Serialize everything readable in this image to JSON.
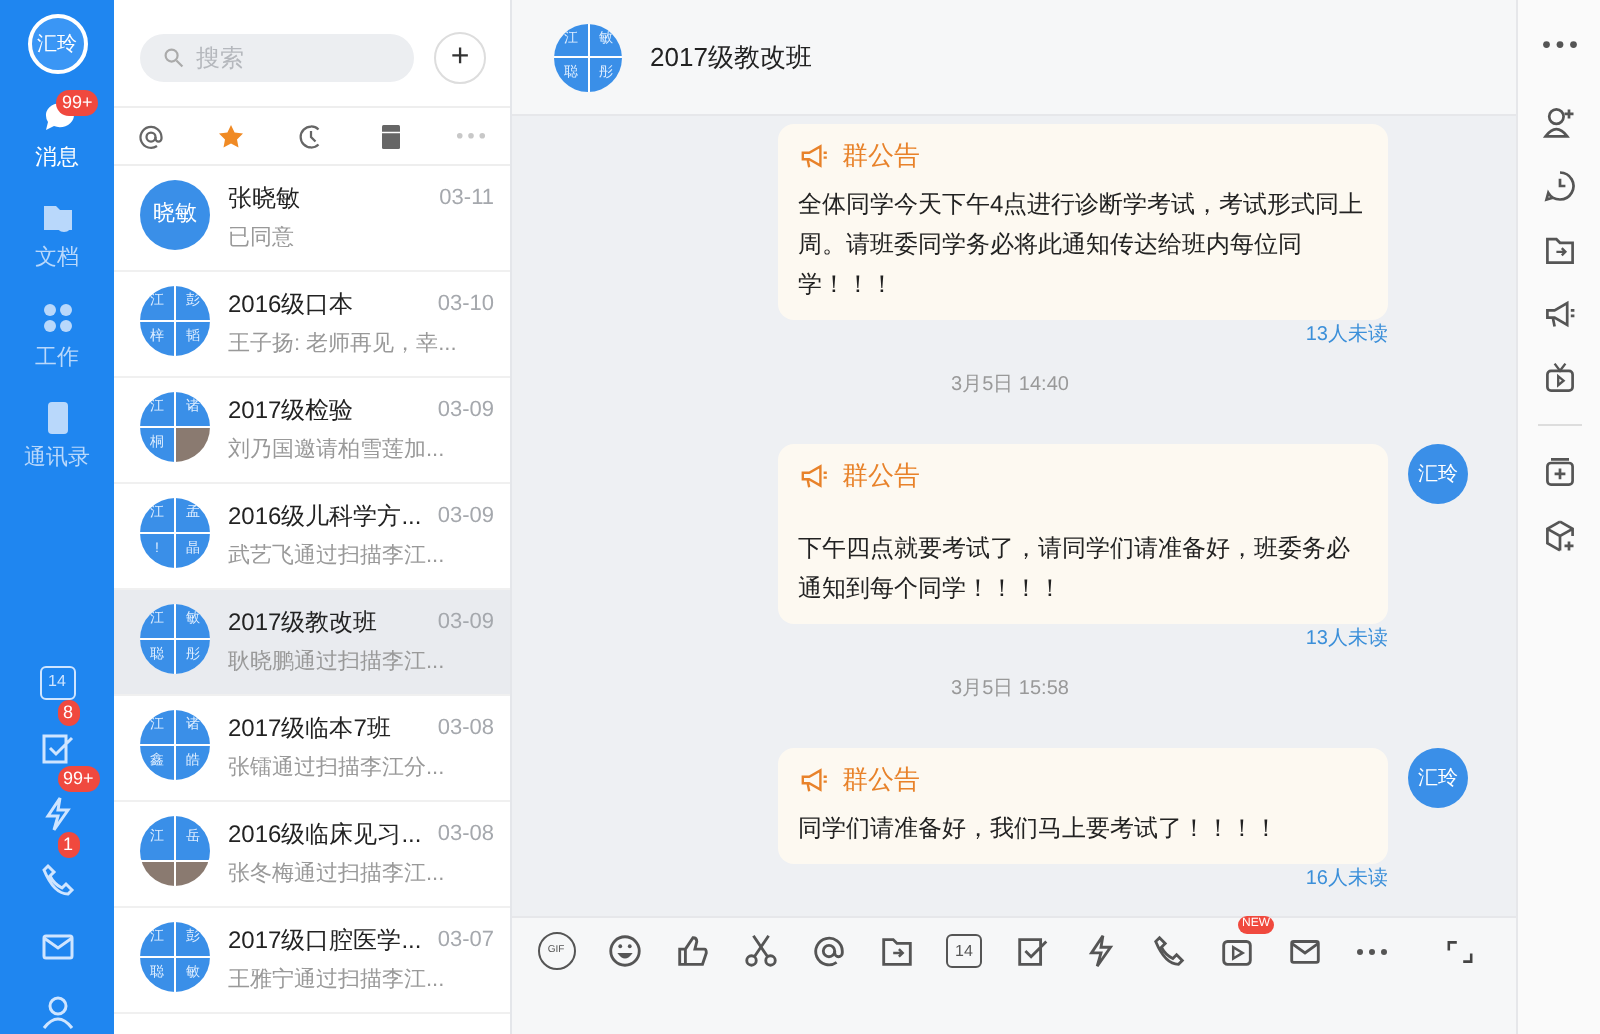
{
  "rail": {
    "avatar": "汇玲",
    "nav": [
      {
        "kind": "chat",
        "label": "消息",
        "selected": true,
        "badge": "99+"
      },
      {
        "kind": "docs",
        "label": "文档",
        "selected": false
      },
      {
        "kind": "work",
        "label": "工作",
        "selected": false
      },
      {
        "kind": "contacts",
        "label": "通讯录",
        "selected": false
      }
    ],
    "tools": [
      {
        "kind": "calendar",
        "label": "14"
      },
      {
        "kind": "check",
        "badge": "8"
      },
      {
        "kind": "bolt",
        "badge": "99+"
      },
      {
        "kind": "phone",
        "badge": "1"
      },
      {
        "kind": "mail"
      },
      {
        "kind": "person"
      }
    ]
  },
  "list": {
    "search": {
      "placeholder": "搜索"
    },
    "add": "+",
    "filters": [
      {
        "kind": "at",
        "selected": false
      },
      {
        "kind": "star",
        "selected": true
      },
      {
        "kind": "recent",
        "selected": false
      },
      {
        "kind": "archive",
        "selected": false
      },
      {
        "kind": "more",
        "selected": false
      }
    ],
    "chats": [
      {
        "name": "张晓敏",
        "time": "03-11",
        "preview": "已同意",
        "avatar": {
          "kind": "single",
          "text": "晓敏"
        },
        "selected": false
      },
      {
        "name": "2016级口本",
        "time": "03-10",
        "preview": "王子扬: 老师再见，幸...",
        "avatar": {
          "kind": "group",
          "cells": [
            {
              "kind": "text",
              "text": "江"
            },
            {
              "kind": "text",
              "text": "彭"
            },
            {
              "kind": "text",
              "text": "梓"
            },
            {
              "kind": "text",
              "text": "韬"
            }
          ]
        },
        "selected": false
      },
      {
        "name": "2017级检验",
        "time": "03-09",
        "preview": "刘乃国邀请柏雪莲加...",
        "avatar": {
          "kind": "group",
          "cells": [
            {
              "kind": "text",
              "text": "江"
            },
            {
              "kind": "text",
              "text": "诸"
            },
            {
              "kind": "text",
              "text": "桐"
            },
            {
              "kind": "photo"
            }
          ]
        },
        "selected": false
      },
      {
        "name": "2016级儿科学方...",
        "time": "03-09",
        "preview": "武艺飞通过扫描李江...",
        "avatar": {
          "kind": "group",
          "cells": [
            {
              "kind": "text",
              "text": "江"
            },
            {
              "kind": "text",
              "text": "孟"
            },
            {
              "kind": "text",
              "text": "!"
            },
            {
              "kind": "text",
              "text": "晶"
            }
          ]
        },
        "selected": false
      },
      {
        "name": "2017级教改班",
        "time": "03-09",
        "preview": "耿晓鹏通过扫描李江...",
        "avatar": {
          "kind": "group",
          "cells": [
            {
              "kind": "text",
              "text": "江"
            },
            {
              "kind": "text",
              "text": "敏"
            },
            {
              "kind": "text",
              "text": "聪"
            },
            {
              "kind": "text",
              "text": "彤"
            }
          ]
        },
        "selected": true
      },
      {
        "name": "2017级临本7班",
        "time": "03-08",
        "preview": "张镭通过扫描李江分...",
        "avatar": {
          "kind": "group",
          "cells": [
            {
              "kind": "text",
              "text": "江"
            },
            {
              "kind": "text",
              "text": "诸"
            },
            {
              "kind": "text",
              "text": "鑫"
            },
            {
              "kind": "text",
              "text": "皓"
            }
          ]
        },
        "selected": false
      },
      {
        "name": "2016级临床见习...",
        "time": "03-08",
        "preview": "张冬梅通过扫描李江...",
        "avatar": {
          "kind": "group",
          "cells": [
            {
              "kind": "text",
              "text": "江"
            },
            {
              "kind": "text",
              "text": "岳"
            },
            {
              "kind": "photo"
            },
            {
              "kind": "photo"
            }
          ]
        },
        "selected": false
      },
      {
        "name": "2017级口腔医学...",
        "time": "03-07",
        "preview": "王雅宁通过扫描李江...",
        "avatar": {
          "kind": "group",
          "cells": [
            {
              "kind": "text",
              "text": "江"
            },
            {
              "kind": "text",
              "text": "彭"
            },
            {
              "kind": "text",
              "text": "聪"
            },
            {
              "kind": "text",
              "text": "敏"
            }
          ]
        },
        "selected": false
      }
    ]
  },
  "chat": {
    "title": "2017级教改班",
    "avatar": {
      "kind": "group",
      "cells": [
        {
          "kind": "text",
          "text": "江"
        },
        {
          "kind": "text",
          "text": "敏"
        },
        {
          "kind": "text",
          "text": "聪"
        },
        {
          "kind": "text",
          "text": "彤"
        }
      ]
    },
    "messages": [
      {
        "kind": "notice",
        "title": "群公告",
        "body": "全体同学今天下午4点进行诊断学考试，考试形式同上周。请班委同学务必将此通知传达给班内每位同学！！！",
        "unread": "13人未读"
      },
      {
        "kind": "time",
        "text": "3月5日 14:40"
      },
      {
        "kind": "notice",
        "title": "群公告",
        "body": "下午四点就要考试了，请同学们请准备好，班委务必通知到每个同学！！！！",
        "unread": "13人未读",
        "sender": "汇玲",
        "gap": true
      },
      {
        "kind": "time",
        "text": "3月5日 15:58"
      },
      {
        "kind": "notice",
        "title": "群公告",
        "body": "同学们请准备好，我们马上要考试了！！！！",
        "unread": "16人未读",
        "sender": "汇玲"
      }
    ],
    "toolbar": [
      {
        "kind": "gif",
        "label": "GIF"
      },
      {
        "kind": "emoji"
      },
      {
        "kind": "like"
      },
      {
        "kind": "scissors"
      },
      {
        "kind": "at"
      },
      {
        "kind": "folder"
      },
      {
        "kind": "calendar",
        "label": "14"
      },
      {
        "kind": "check"
      },
      {
        "kind": "bolt"
      },
      {
        "kind": "phone"
      },
      {
        "kind": "video",
        "badge": "NEW"
      },
      {
        "kind": "mail"
      },
      {
        "kind": "more"
      }
    ],
    "side": [
      {
        "kind": "more"
      },
      {
        "kind": "add-person"
      },
      {
        "kind": "clock"
      },
      {
        "kind": "folder"
      },
      {
        "kind": "megaphone"
      },
      {
        "kind": "tv"
      },
      {
        "kind": "divider"
      },
      {
        "kind": "box-plus"
      },
      {
        "kind": "cube-plus"
      }
    ]
  }
}
